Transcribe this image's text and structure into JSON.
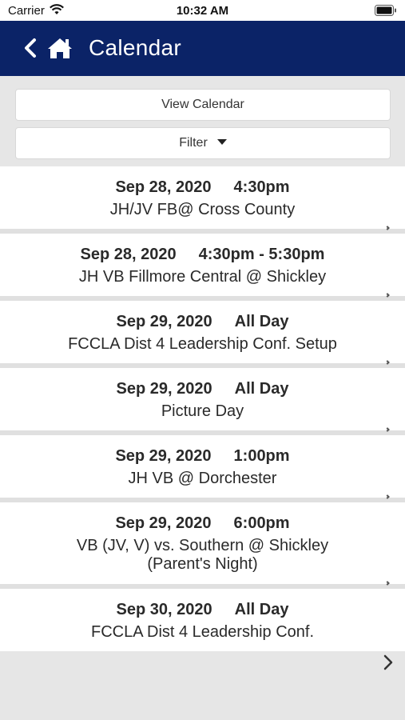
{
  "status": {
    "carrier": "Carrier",
    "time": "10:32 AM"
  },
  "nav": {
    "title": "Calendar",
    "back_icon": "chevron-left-icon",
    "home_icon": "home-icon"
  },
  "buttons": {
    "view_calendar": "View Calendar",
    "filter": "Filter"
  },
  "events": [
    {
      "date": "Sep 28, 2020",
      "time": "4:30pm",
      "title": "JH/JV FB@ Cross County"
    },
    {
      "date": "Sep 28, 2020",
      "time": "4:30pm - 5:30pm",
      "title": "JH VB Fillmore Central @ Shickley"
    },
    {
      "date": "Sep 29, 2020",
      "time": "All Day",
      "title": "FCCLA Dist 4 Leadership Conf. Setup"
    },
    {
      "date": "Sep 29, 2020",
      "time": "All Day",
      "title": "Picture Day"
    },
    {
      "date": "Sep 29, 2020",
      "time": "1:00pm",
      "title": "JH VB @ Dorchester"
    },
    {
      "date": "Sep 29, 2020",
      "time": "6:00pm",
      "title": "VB (JV, V) vs. Southern @ Shickley (Parent's Night)"
    },
    {
      "date": "Sep 30, 2020",
      "time": "All Day",
      "title": "FCCLA Dist 4 Leadership Conf."
    }
  ],
  "colors": {
    "nav_bg": "#0b2367",
    "page_bg": "#e6e6e6"
  }
}
